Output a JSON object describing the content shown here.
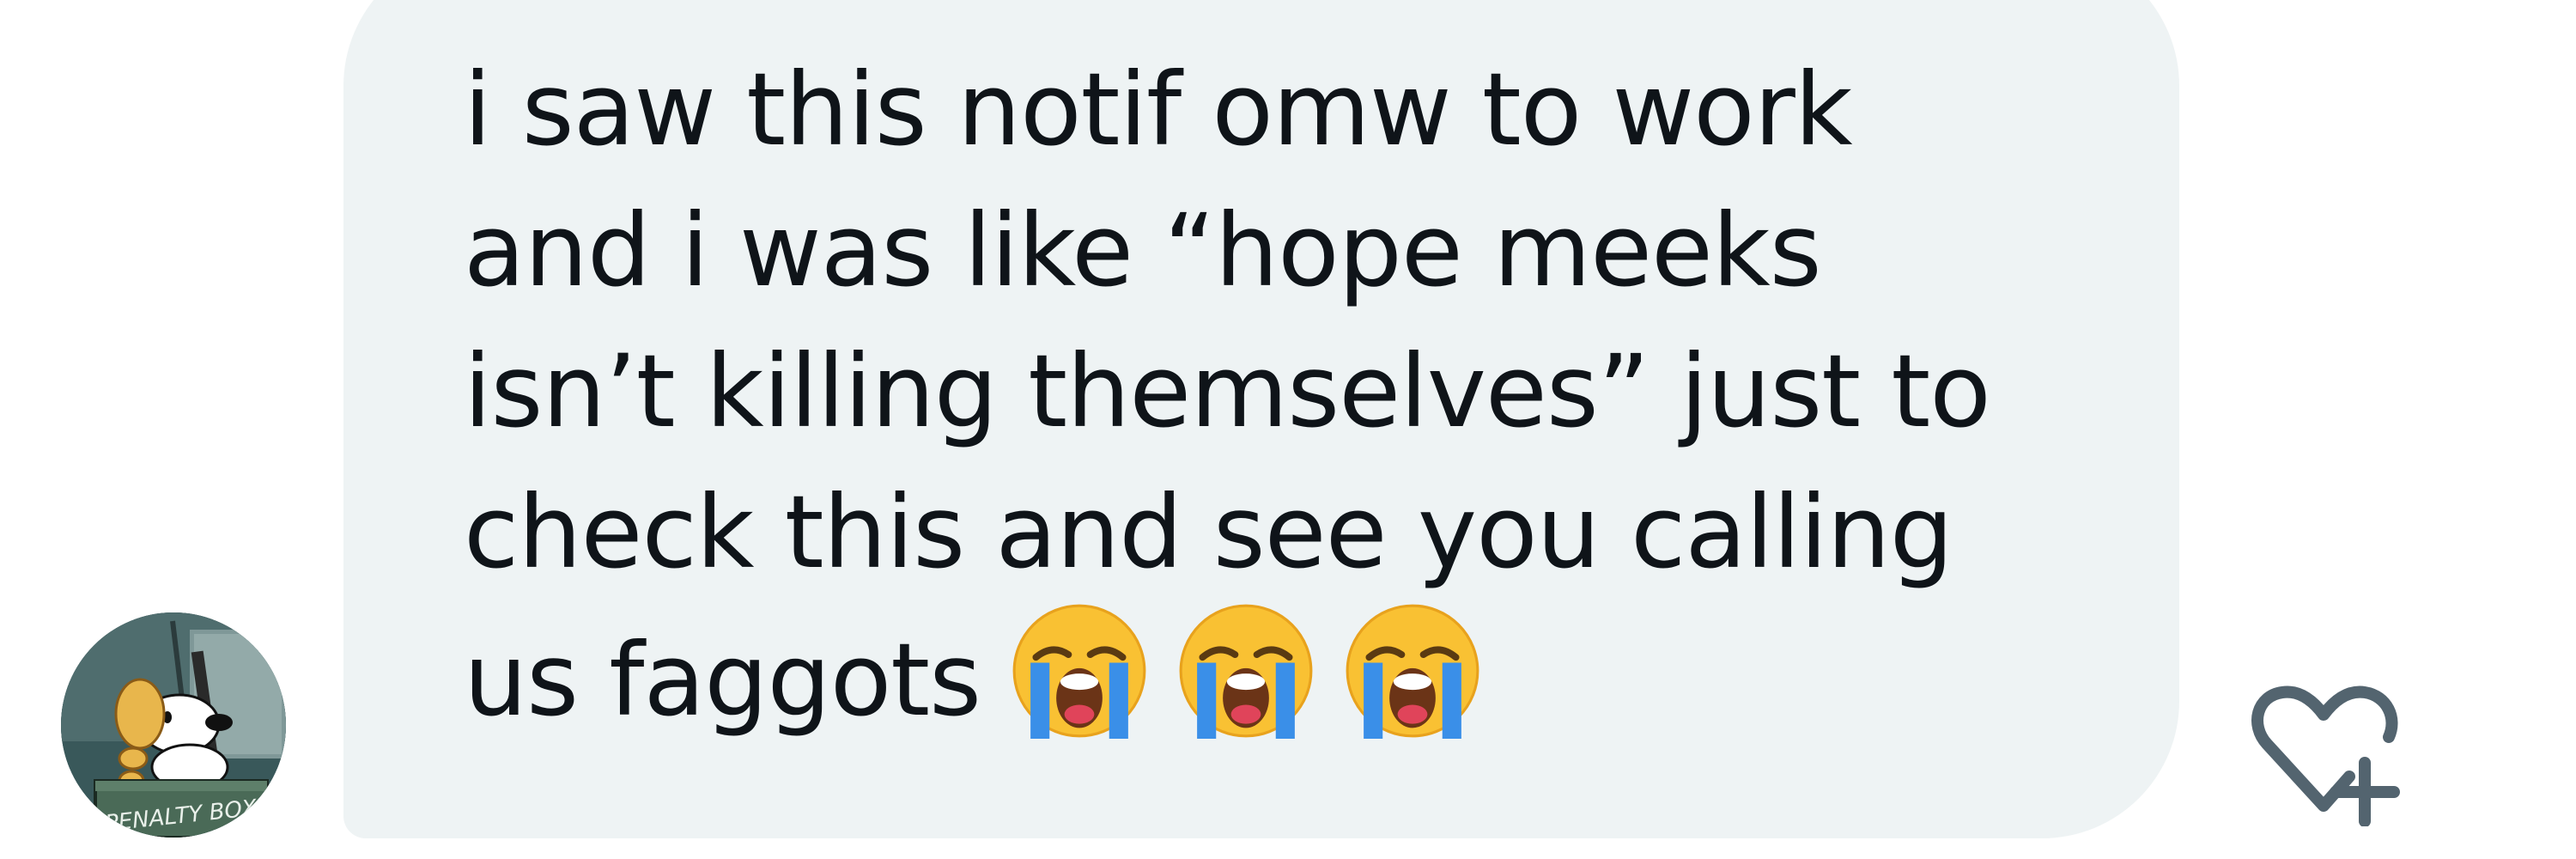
{
  "message": {
    "lines": [
      "i saw this notif omw to work",
      "and i was like “hope meeks",
      "isn’t killing themselves” just to",
      "check this and see you calling",
      "us faggots"
    ],
    "emojis": [
      "loudly-crying-face",
      "loudly-crying-face",
      "loudly-crying-face"
    ]
  },
  "avatar": {
    "sign_text": "PENALTY BOX"
  },
  "actions": {
    "react_icon": "heart-plus-icon"
  },
  "colors": {
    "bubble": "#eef3f4",
    "text": "#0f1419",
    "icon": "#53646f"
  }
}
